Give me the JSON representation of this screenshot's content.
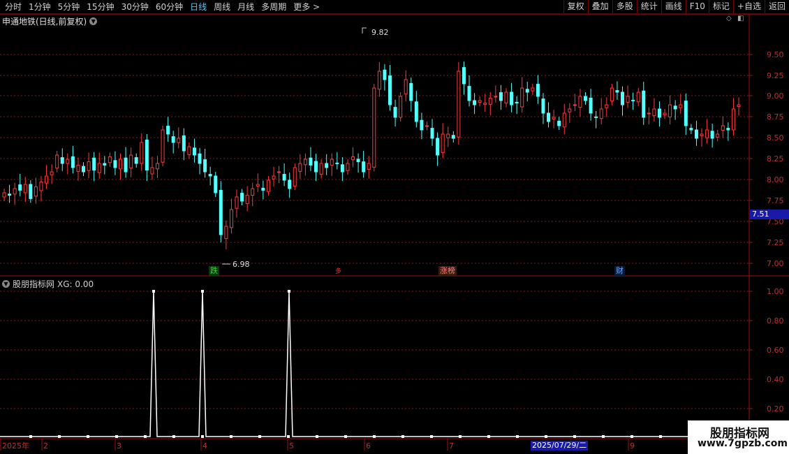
{
  "toolbar": {
    "periods": [
      "分时",
      "1分钟",
      "5分钟",
      "15分钟",
      "30分钟",
      "60分钟",
      "日线",
      "周线",
      "月线",
      "多周期",
      "更多 >"
    ],
    "active_period": "日线",
    "right_buttons": [
      "复权",
      "叠加",
      "多股",
      "统计",
      "画线",
      "F10",
      "标记",
      "+自选",
      "返回"
    ]
  },
  "chart": {
    "stock_title": "申通地铁(日线,前复权)",
    "price_axis": [
      "9.50",
      "9.25",
      "9.00",
      "8.75",
      "8.50",
      "8.25",
      "8.00",
      "7.75",
      "7.50",
      "7.25",
      "7.00"
    ],
    "high_label": "9.82",
    "low_label": "6.98",
    "current_price": "7.51",
    "tags": [
      {
        "text": "跌",
        "color": "#00b000"
      },
      {
        "text": "多",
        "color": "#ff3030"
      },
      {
        "text": "涨榜",
        "color": "#ff4040"
      },
      {
        "text": "财",
        "color": "#3a8bff"
      }
    ]
  },
  "indicator": {
    "title": "股朋指标网",
    "value_text": "XG: 0.00",
    "axis": [
      "1.00",
      "0.80",
      "0.60",
      "0.40",
      "0.20"
    ]
  },
  "date_axis": {
    "labels": [
      "2025年",
      "2",
      "3",
      "4",
      "5",
      "6",
      "7",
      "9"
    ],
    "cursor_date": "2025/07/29/二"
  },
  "watermark": {
    "line1": "股朋指标网",
    "line2": "www.7gpzb.com"
  },
  "colors": {
    "up": "#ff3b3b",
    "down": "#54ffff",
    "grid": "#8a1a1a",
    "axis": "#a01010",
    "highlight": "#55c8ff"
  }
}
